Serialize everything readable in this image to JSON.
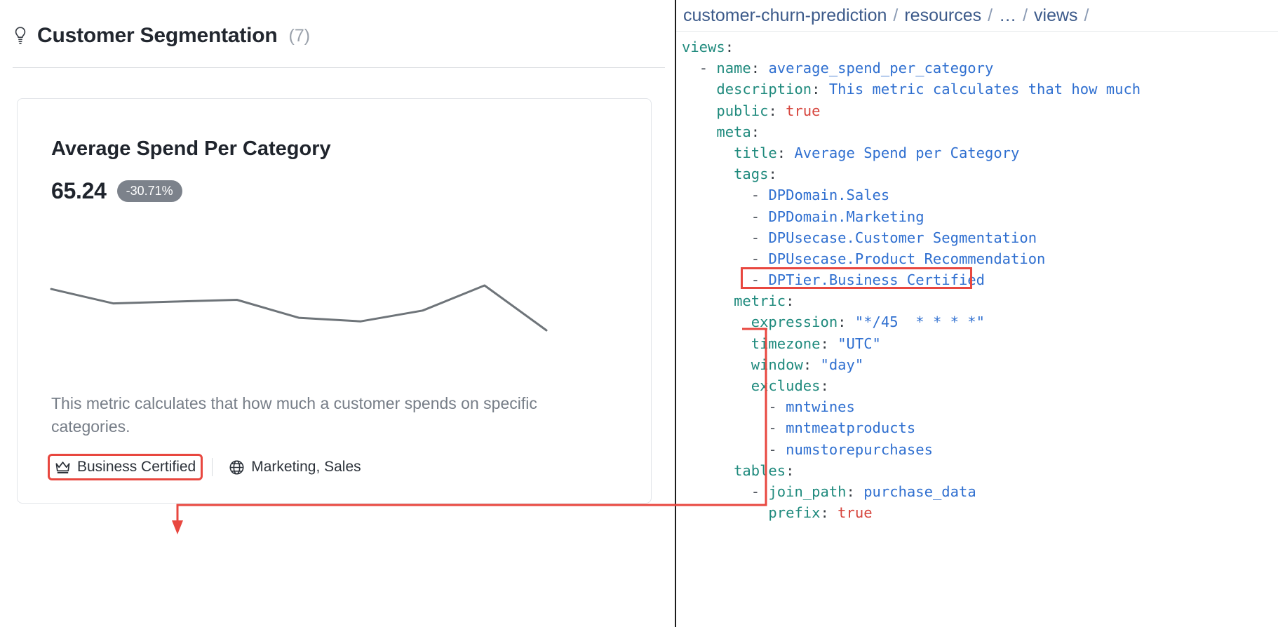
{
  "section": {
    "icon": "lightbulb-icon",
    "title": "Customer Segmentation",
    "count": "(7)"
  },
  "card": {
    "title": "Average Spend Per Category",
    "value": "65.24",
    "delta": "-30.71%",
    "delta_color": "#7c828b",
    "description": "This metric calculates that how much a customer spends on specific categories.",
    "tier_badge": {
      "icon": "crown-icon",
      "label": "Business Certified",
      "highlight_color": "#e8473f"
    },
    "domain_badge": {
      "icon": "globe-icon",
      "label": "Marketing, Sales"
    }
  },
  "breadcrumb": {
    "parts": [
      "customer-churn-prediction",
      "resources",
      "…",
      "views",
      ""
    ],
    "separator": "/"
  },
  "yaml": {
    "lines": [
      {
        "indent": 0,
        "key": "views",
        "value": ""
      },
      {
        "indent": 1,
        "dash": true,
        "key": "name",
        "value": "average_spend_per_category"
      },
      {
        "indent": 2,
        "key": "description",
        "value": "This metric calculates that how much"
      },
      {
        "indent": 2,
        "key": "public",
        "value": "true",
        "type": "bool"
      },
      {
        "indent": 2,
        "key": "meta",
        "value": ""
      },
      {
        "indent": 3,
        "key": "title",
        "value": "Average Spend per Category"
      },
      {
        "indent": 3,
        "key": "tags",
        "value": ""
      },
      {
        "indent": 4,
        "dash": true,
        "value": "DPDomain.Sales"
      },
      {
        "indent": 4,
        "dash": true,
        "value": "DPDomain.Marketing"
      },
      {
        "indent": 4,
        "dash": true,
        "value": "DPUsecase.Customer Segmentation"
      },
      {
        "indent": 4,
        "dash": true,
        "value": "DPUsecase.Product Recommendation"
      },
      {
        "indent": 4,
        "dash": true,
        "value": "DPTier.Business Certified",
        "highlighted": true
      },
      {
        "indent": 3,
        "key": "metric",
        "value": ""
      },
      {
        "indent": 4,
        "key": "expression",
        "value": "\"*/45  * * * *\""
      },
      {
        "indent": 4,
        "key": "timezone",
        "value": "\"UTC\""
      },
      {
        "indent": 4,
        "key": "window",
        "value": "\"day\""
      },
      {
        "indent": 4,
        "key": "excludes",
        "value": ""
      },
      {
        "indent": 5,
        "dash": true,
        "value": "mntwines"
      },
      {
        "indent": 5,
        "dash": true,
        "value": "mntmeatproducts"
      },
      {
        "indent": 5,
        "dash": true,
        "value": "numstorepurchases"
      },
      {
        "indent": 3,
        "key": "tables",
        "value": ""
      },
      {
        "indent": 4,
        "dash": true,
        "key": "join_path",
        "value": "purchase_data"
      },
      {
        "indent": 5,
        "key": "prefix",
        "value": "true",
        "type": "bool"
      }
    ],
    "colors": {
      "key": "#1f8a7d",
      "value": "#2f6fd0",
      "bool": "#d6443c"
    }
  },
  "annotation": {
    "color": "#e8473f",
    "description": "Red connector linking the DPTier.Business Certified YAML tag to the Business Certified badge on the card"
  },
  "chart_data": {
    "type": "line",
    "title": "Average Spend Per Category",
    "xlabel": "",
    "ylabel": "",
    "x": [
      0,
      1,
      2,
      3,
      4,
      5,
      6,
      7,
      8
    ],
    "values": [
      64,
      56,
      57,
      58,
      48,
      46,
      52,
      66,
      41
    ],
    "grid": false,
    "legend": "none",
    "line_color": "#6e7479"
  }
}
